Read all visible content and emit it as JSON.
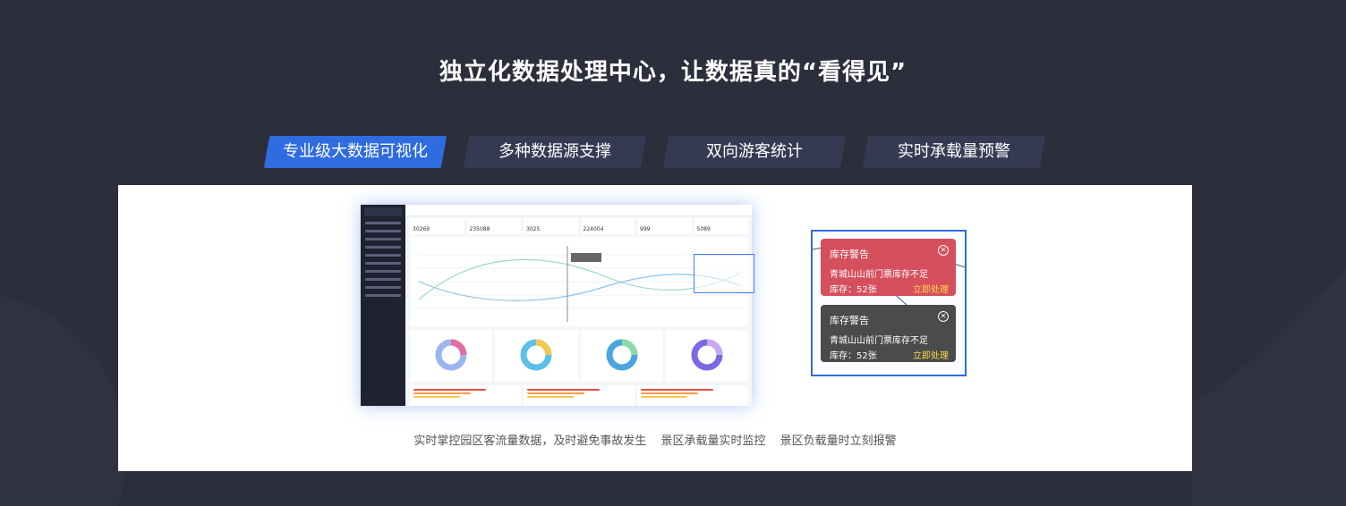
{
  "headline": "独立化数据处理中心，让数据真的“看得见”",
  "tabs": [
    {
      "label": "专业级大数据可视化",
      "active": true
    },
    {
      "label": "多种数据源支撑",
      "active": false
    },
    {
      "label": "双向游客统计",
      "active": false
    },
    {
      "label": "实时承载量预警",
      "active": false
    }
  ],
  "alerts": [
    {
      "title": "库存警告",
      "message": "青城山山前门票库存不足",
      "stock": "库存：52张",
      "action": "立即处理",
      "color": "#d64f5d"
    },
    {
      "title": "库存警告",
      "message": "青城山山前门票库存不足",
      "stock": "库存：52张",
      "action": "立即处理",
      "color": "#4b4b4b"
    }
  ],
  "caption": [
    "实时掌控园区客流量数据，及时避免事故发生",
    "景区承载量实时监控",
    "景区负载量时立刻报警"
  ],
  "dashboard_kpis": [
    "30269",
    "235088",
    "3025",
    "224004",
    "999",
    "5089"
  ],
  "colors": {
    "accent": "#2f6ce0",
    "background": "#2c2e3c",
    "tab_inactive": "#353a52"
  }
}
